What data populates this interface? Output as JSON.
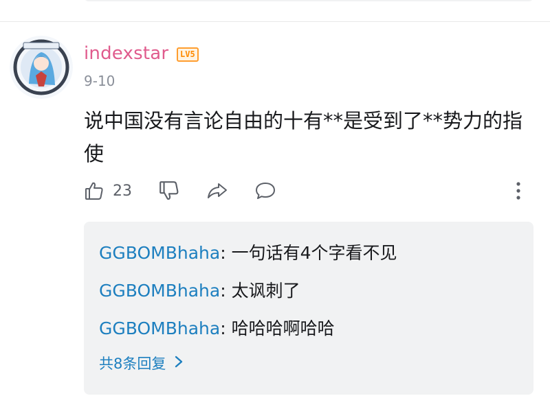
{
  "comment": {
    "username": "indexstar",
    "level_badge": "LV5",
    "date": "9-10",
    "content": "说中国没有言论自由的十有**是受到了**势力的指使",
    "like_count": "23",
    "icons": {
      "like": "thumbs-up-icon",
      "dislike": "thumbs-down-icon",
      "share": "share-icon",
      "reply": "comment-icon",
      "more": "more-vertical-icon"
    }
  },
  "replies": {
    "items": [
      {
        "author": "GGBOMBhaha",
        "separator": ": ",
        "text": "一句话有4个字看不见"
      },
      {
        "author": "GGBOMBhaha",
        "separator": ": ",
        "text": "太讽刺了"
      },
      {
        "author": "GGBOMBhaha",
        "separator": ": ",
        "text": "哈哈哈啊哈哈"
      }
    ],
    "more_label": "共8条回复"
  },
  "colors": {
    "username": "#e05b8d",
    "reply_author": "#1d7fbf",
    "level_badge": "#ff8a00",
    "reply_background": "#f1f2f3",
    "secondary_text": "#8a8f99"
  }
}
